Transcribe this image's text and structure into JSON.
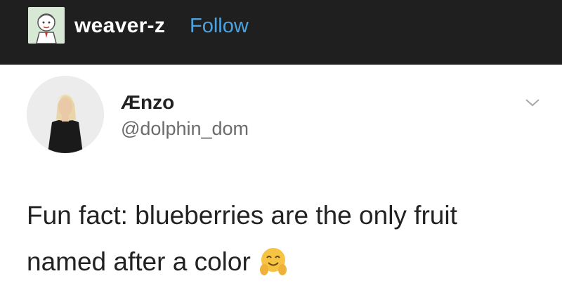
{
  "header": {
    "username": "weaver-z",
    "follow_label": "Follow",
    "colors": {
      "background": "#1f1f1f",
      "follow": "#4aa3e0"
    }
  },
  "tweet": {
    "display_name": "Ænzo",
    "handle": "@dolphin_dom",
    "text_line_1": "Fun fact: blueberries are the only fruit",
    "text_line_2": "named after a color",
    "emoji": "smiling-face-with-open-hands-emoji",
    "menu_icon": "chevron-down-icon"
  }
}
